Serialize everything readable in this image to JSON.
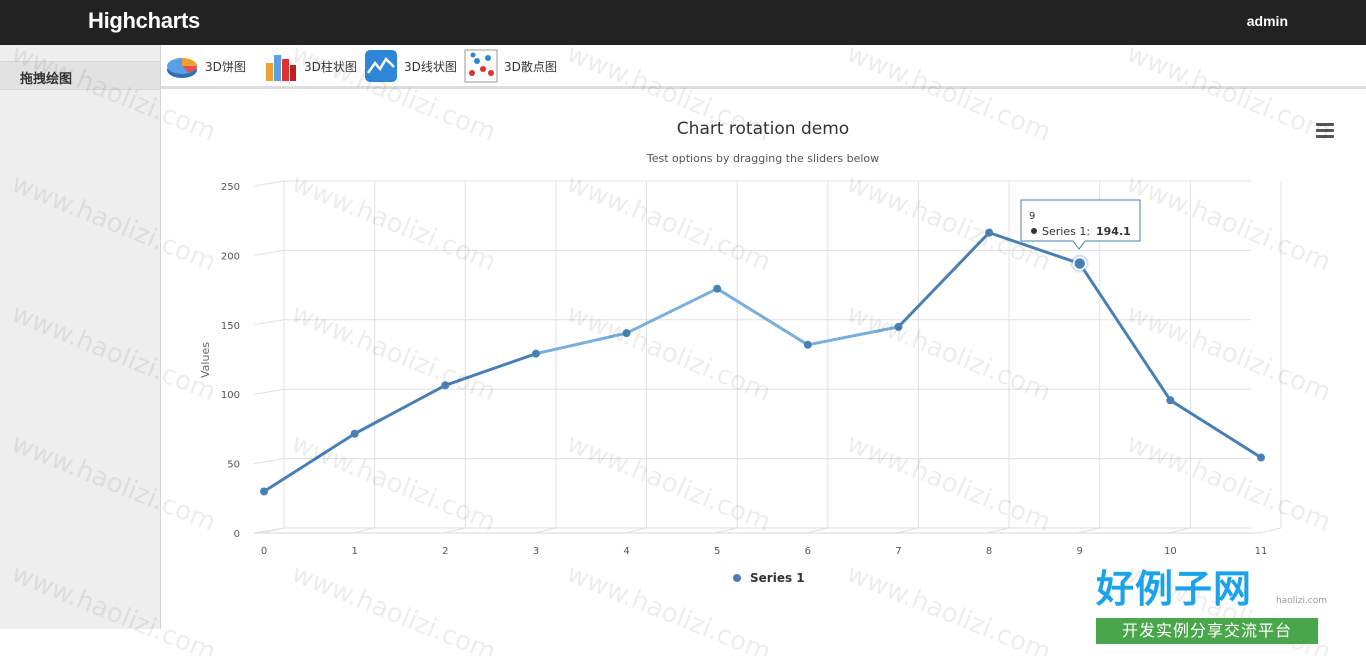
{
  "header": {
    "brand": "Highcharts",
    "user": "admin"
  },
  "sidebar": {
    "items": [
      {
        "label": "拖拽绘图"
      }
    ]
  },
  "toolbar": {
    "items": [
      {
        "label": "3D饼图",
        "icon": "pie-chart-icon"
      },
      {
        "label": "3D柱状图",
        "icon": "bar-chart-icon"
      },
      {
        "label": "3D线状图",
        "icon": "line-chart-icon"
      },
      {
        "label": "3D散点图",
        "icon": "scatter-chart-icon"
      }
    ]
  },
  "tooltip": {
    "x_label": "9",
    "series_label": "Series 1:",
    "value_label": "194.1"
  },
  "watermark": {
    "text": "www.haolizi.com",
    "logo_big": "好例子网",
    "logo_small": "开发实例分享交流平台",
    "domain": "haolizi.com"
  },
  "colors": {
    "series": "#4a7fb5",
    "series_light": "#7aaedc",
    "grid": "#e0e0e0",
    "topbar": "#222222"
  },
  "chart_data": {
    "type": "line",
    "title": "Chart rotation demo",
    "subtitle": "Test options by dragging the sliders below",
    "ylabel": "Values",
    "xlabel": "",
    "x": [
      0,
      1,
      2,
      3,
      4,
      5,
      6,
      7,
      8,
      9,
      10,
      11
    ],
    "series": [
      {
        "name": "Series 1",
        "values": [
          29.9,
          71.5,
          106.4,
          129.2,
          144.0,
          176.0,
          135.6,
          148.5,
          216.4,
          194.1,
          95.6,
          54.4
        ]
      }
    ],
    "yticks": [
      0,
      50,
      100,
      150,
      200,
      250
    ],
    "ylim": [
      0,
      250
    ],
    "xlim": [
      0,
      11
    ],
    "grid": true,
    "legend_position": "bottom-center",
    "highlighted_index": 9
  }
}
